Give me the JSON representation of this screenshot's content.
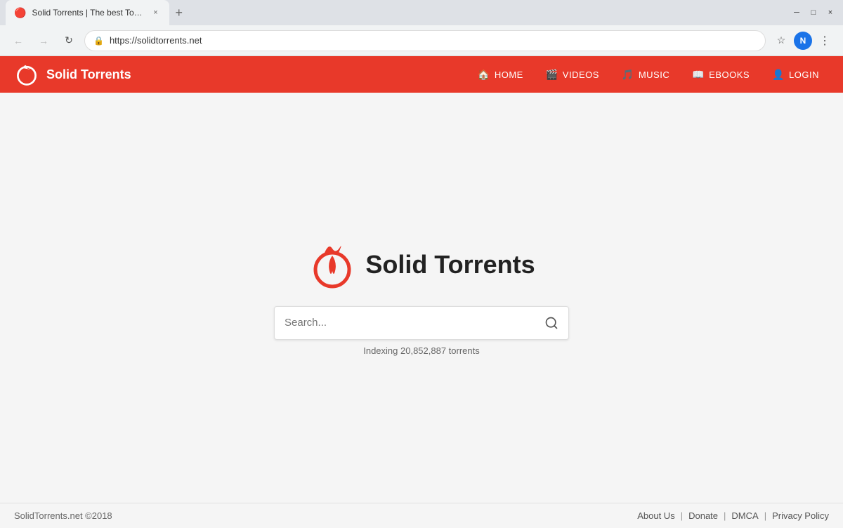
{
  "browser": {
    "tab": {
      "title": "Solid Torrents | The best Torrent...",
      "favicon": "🔴",
      "close_label": "×"
    },
    "new_tab_label": "+",
    "window_controls": {
      "minimize": "─",
      "maximize": "□",
      "close": "×"
    },
    "address": {
      "url": "https://solidtorrents.net",
      "lock_icon": "🔒",
      "back_icon": "←",
      "forward_icon": "→",
      "reload_icon": "↻",
      "star_icon": "☆",
      "profile_label": "N",
      "menu_icon": "⋮"
    }
  },
  "site": {
    "header": {
      "logo_text": "Solid Torrents",
      "nav_items": [
        {
          "label": "HOME",
          "icon": "🏠"
        },
        {
          "label": "VIDEOS",
          "icon": "🎬"
        },
        {
          "label": "MUSIC",
          "icon": "🎵"
        },
        {
          "label": "EBOOKS",
          "icon": "📖"
        },
        {
          "label": "LOGIN",
          "icon": "👤"
        }
      ]
    },
    "main": {
      "logo_text": "Solid Torrents",
      "search_placeholder": "Search...",
      "search_icon": "🔍",
      "indexing_text": "Indexing 20,852,887 torrents"
    },
    "footer": {
      "copyright": "SolidTorrents.net ©2018",
      "links": [
        {
          "label": "About Us"
        },
        {
          "label": "Donate"
        },
        {
          "label": "DMCA"
        },
        {
          "label": "Privacy Policy"
        }
      ]
    }
  },
  "colors": {
    "brand_red": "#e8392a",
    "nav_bg": "#dee1e6",
    "page_bg": "#f5f5f5"
  }
}
